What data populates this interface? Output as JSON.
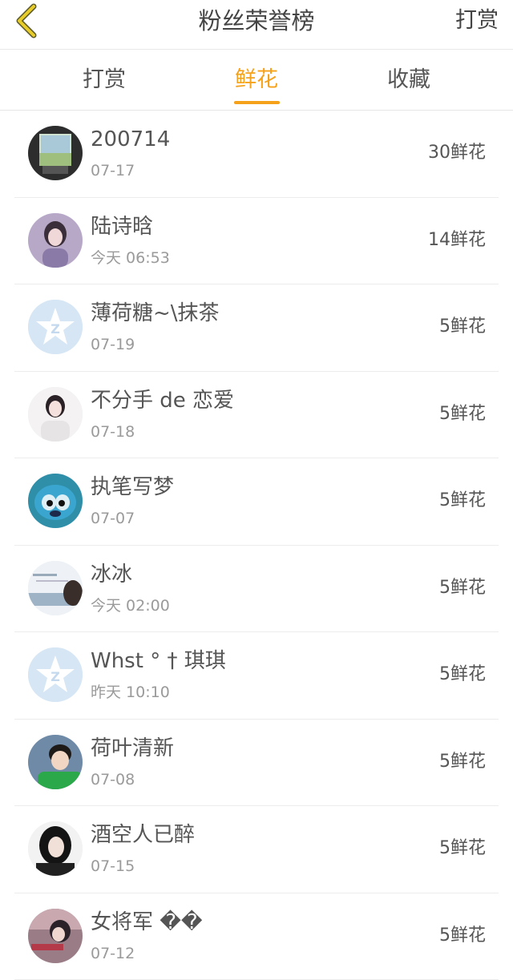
{
  "header": {
    "title": "粉丝荣誉榜",
    "right_action": "打赏",
    "back_icon": "chevron-left-icon",
    "back_color": "#e0c020"
  },
  "tabs": [
    {
      "label": "打赏",
      "active": false
    },
    {
      "label": "鲜花",
      "active": true
    },
    {
      "label": "收藏",
      "active": false
    }
  ],
  "accent_color": "#f5a11a",
  "fans": [
    {
      "name": "200714",
      "time": "07-17",
      "amount": "30鲜花",
      "avatar": "avatar-photo-window"
    },
    {
      "name": "陆诗晗",
      "time": "今天 06:53",
      "amount": "14鲜花",
      "avatar": "avatar-photo-girl"
    },
    {
      "name": "薄荷糖~\\抹茶",
      "time": "07-19",
      "amount": "5鲜花",
      "avatar": "avatar-default-qzone"
    },
    {
      "name": "不分手 de 恋爱",
      "time": "07-18",
      "amount": "5鲜花",
      "avatar": "avatar-photo-girl-light"
    },
    {
      "name": "执笔写梦",
      "time": "07-07",
      "amount": "5鲜花",
      "avatar": "avatar-cartoon-blue"
    },
    {
      "name": "冰冰",
      "time": "今天 02:00",
      "amount": "5鲜花",
      "avatar": "avatar-photo-text"
    },
    {
      "name": "Whst ° † 琪琪",
      "time": "昨天 10:10",
      "amount": "5鲜花",
      "avatar": "avatar-default-qzone"
    },
    {
      "name": "荷叶清新",
      "time": "07-08",
      "amount": "5鲜花",
      "avatar": "avatar-photo-child"
    },
    {
      "name": "酒空人已醉",
      "time": "07-15",
      "amount": "5鲜花",
      "avatar": "avatar-photo-woman-dark"
    },
    {
      "name": "女将军 ��",
      "time": "07-12",
      "amount": "5鲜花",
      "avatar": "avatar-photo-woman-scene"
    }
  ]
}
